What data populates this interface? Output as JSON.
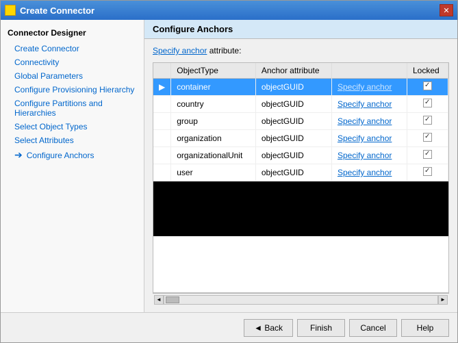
{
  "window": {
    "title": "Create Connector",
    "close_label": "✕"
  },
  "sidebar": {
    "title": "Connector Designer",
    "items": [
      {
        "label": "Create Connector",
        "indent": false,
        "current": false,
        "arrow": false
      },
      {
        "label": "Connectivity",
        "indent": true,
        "current": false,
        "arrow": false
      },
      {
        "label": "Global Parameters",
        "indent": true,
        "current": false,
        "arrow": false
      },
      {
        "label": "Configure Provisioning Hierarchy",
        "indent": true,
        "current": false,
        "arrow": false
      },
      {
        "label": "Configure Partitions and Hierarchies",
        "indent": true,
        "current": false,
        "arrow": false
      },
      {
        "label": "Select Object Types",
        "indent": true,
        "current": false,
        "arrow": false
      },
      {
        "label": "Select Attributes",
        "indent": true,
        "current": false,
        "arrow": false
      },
      {
        "label": "Configure Anchors",
        "indent": true,
        "current": true,
        "arrow": true
      }
    ]
  },
  "panel": {
    "header": "Configure Anchors",
    "intro_prefix": "",
    "intro_link": "Specify anchor",
    "intro_suffix": " attribute:"
  },
  "table": {
    "columns": [
      {
        "label": "",
        "key": "arrow_col"
      },
      {
        "label": "ObjectType",
        "key": "objectType"
      },
      {
        "label": "Anchor attribute",
        "key": "anchorAttribute"
      },
      {
        "label": "",
        "key": "action"
      },
      {
        "label": "Locked",
        "key": "locked"
      }
    ],
    "rows": [
      {
        "arrow": "▶",
        "objectType": "container",
        "anchorAttribute": "objectGUID",
        "action": "Specify anchor",
        "locked": true,
        "selected": true
      },
      {
        "arrow": "",
        "objectType": "country",
        "anchorAttribute": "objectGUID",
        "action": "Specify anchor",
        "locked": true,
        "selected": false
      },
      {
        "arrow": "",
        "objectType": "group",
        "anchorAttribute": "objectGUID",
        "action": "Specify anchor",
        "locked": true,
        "selected": false
      },
      {
        "arrow": "",
        "objectType": "organization",
        "anchorAttribute": "objectGUID",
        "action": "Specify anchor",
        "locked": true,
        "selected": false
      },
      {
        "arrow": "",
        "objectType": "organizationalUnit",
        "anchorAttribute": "objectGUID",
        "action": "Specify anchor",
        "locked": true,
        "selected": false
      },
      {
        "arrow": "",
        "objectType": "user",
        "anchorAttribute": "objectGUID",
        "action": "Specify anchor",
        "locked": true,
        "selected": false
      }
    ]
  },
  "footer": {
    "back_label": "◄ Back",
    "finish_label": "Finish",
    "cancel_label": "Cancel",
    "help_label": "Help"
  }
}
